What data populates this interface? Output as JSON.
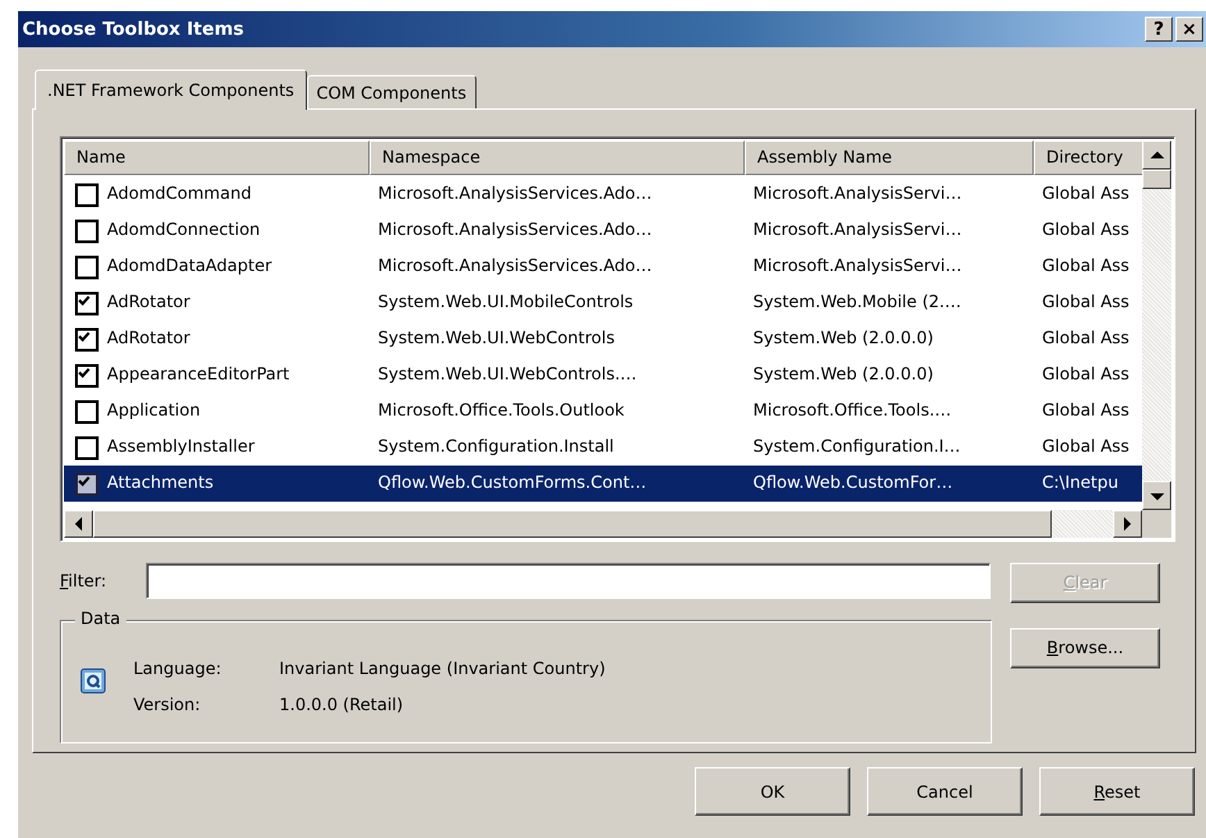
{
  "window": {
    "title": "Choose Toolbox Items",
    "title_buttons": [
      "?",
      "×"
    ]
  },
  "tabs": [
    {
      "label": ".NET Framework Components",
      "selected": true
    },
    {
      "label": "COM Components",
      "selected": false
    }
  ],
  "table": {
    "columns": [
      "Name",
      "Namespace",
      "Assembly Name",
      "Directory"
    ],
    "rows": [
      {
        "name": "AdomdCommand",
        "namespace": "Microsoft.AnalysisServices.Ado…",
        "assembly": "Microsoft.AnalysisServi…",
        "directory": "Global Ass",
        "checked": false,
        "selected": false
      },
      {
        "name": "AdomdConnection",
        "namespace": "Microsoft.AnalysisServices.Ado…",
        "assembly": "Microsoft.AnalysisServi…",
        "directory": "Global Ass",
        "checked": false,
        "selected": false
      },
      {
        "name": "AdomdDataAdapter",
        "namespace": "Microsoft.AnalysisServices.Ado…",
        "assembly": "Microsoft.AnalysisServi…",
        "directory": "Global Ass",
        "checked": false,
        "selected": false
      },
      {
        "name": "AdRotator",
        "namespace": "System.Web.UI.MobileControls",
        "assembly": "System.Web.Mobile (2.…",
        "directory": "Global Ass",
        "checked": true,
        "selected": false
      },
      {
        "name": "AdRotator",
        "namespace": "System.Web.UI.WebControls",
        "assembly": "System.Web (2.0.0.0)",
        "directory": "Global Ass",
        "checked": true,
        "selected": false
      },
      {
        "name": "AppearanceEditorPart",
        "namespace": "System.Web.UI.WebControls.…",
        "assembly": "System.Web (2.0.0.0)",
        "directory": "Global Ass",
        "checked": true,
        "selected": false
      },
      {
        "name": "Application",
        "namespace": "Microsoft.Office.Tools.Outlook",
        "assembly": "Microsoft.Office.Tools.…",
        "directory": "Global Ass",
        "checked": false,
        "selected": false
      },
      {
        "name": "AssemblyInstaller",
        "namespace": "System.Configuration.Install",
        "assembly": "System.Configuration.I…",
        "directory": "Global Ass",
        "checked": false,
        "selected": false
      },
      {
        "name": "Attachments",
        "namespace": "Qflow.Web.CustomForms.Cont…",
        "assembly": "Qflow.Web.CustomFor…",
        "directory": "C:\\Inetpu",
        "checked": true,
        "selected": true
      }
    ]
  },
  "filter": {
    "label": "Filter:"
  },
  "side_buttons": [
    {
      "label": "Clear",
      "disabled": true,
      "access_key_underlined": true
    },
    {
      "label": "Browse...",
      "disabled": false,
      "access_key_underlined": true
    }
  ],
  "data_group": {
    "title": "Data",
    "fields": [
      {
        "label": "Language:",
        "value": "Invariant Language (Invariant Country)"
      },
      {
        "label": "Version:",
        "value": "1.0.0.0 (Retail)"
      }
    ]
  },
  "buttons": [
    {
      "label": "OK",
      "access_key_underlined": false
    },
    {
      "label": "Cancel",
      "access_key_underlined": false
    },
    {
      "label": "Reset",
      "access_key_underlined": true
    }
  ]
}
